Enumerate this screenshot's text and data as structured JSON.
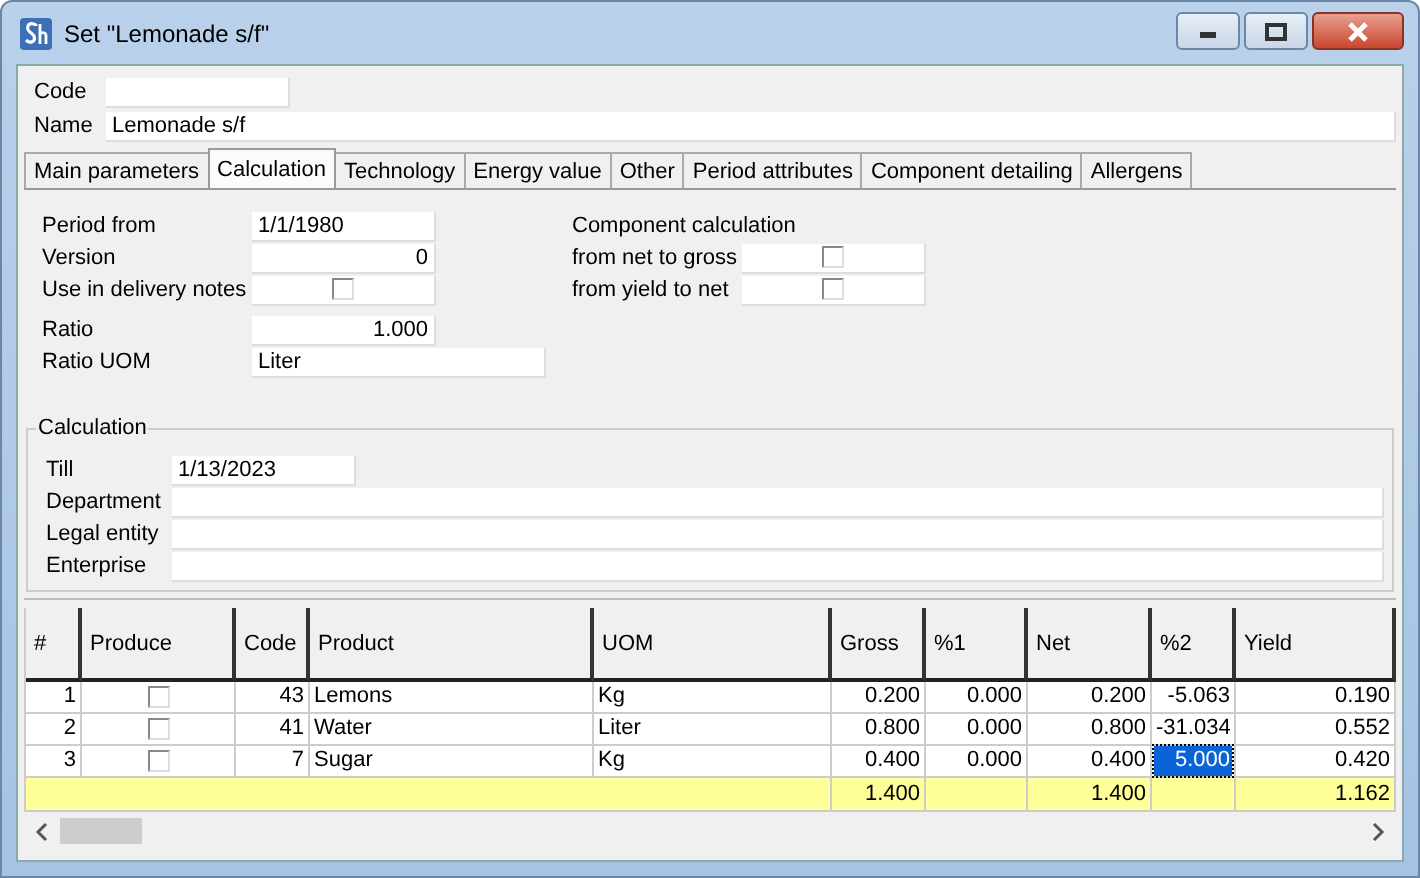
{
  "window": {
    "title": "Set \"Lemonade s/f\""
  },
  "header": {
    "code": {
      "label": "Code"
    },
    "name": {
      "label": "Name",
      "value": "Lemonade s/f"
    }
  },
  "tabs": [
    {
      "label": "Main parameters",
      "selected": false
    },
    {
      "label": "Calculation",
      "selected": true
    },
    {
      "label": "Technology",
      "selected": false
    },
    {
      "label": "Energy value",
      "selected": false
    },
    {
      "label": "Other",
      "selected": false
    },
    {
      "label": "Period attributes",
      "selected": false
    },
    {
      "label": "Component detailing",
      "selected": false
    },
    {
      "label": "Allergens",
      "selected": false
    }
  ],
  "left_fields": [
    {
      "kind": "text",
      "label": "Period from",
      "value": "1/1/1980"
    },
    {
      "kind": "number",
      "label": "Version",
      "value": "0"
    },
    {
      "kind": "checkbox",
      "label": "Use in delivery notes",
      "checked": false
    }
  ],
  "ratio_fields": [
    {
      "kind": "number",
      "label": "Ratio",
      "value": "1.000"
    },
    {
      "kind": "wide",
      "label": "Ratio UOM",
      "value": "Liter"
    }
  ],
  "component_calculation": {
    "title": "Component calculation",
    "options": [
      {
        "label": "from net to gross",
        "checked": false
      },
      {
        "label": "from yield to net",
        "checked": false
      }
    ]
  },
  "calculation_group": {
    "title": "Calculation",
    "till": {
      "label": "Till",
      "value": "1/13/2023"
    },
    "fields": [
      {
        "label": "Department"
      },
      {
        "label": "Legal entity"
      },
      {
        "label": "Enterprise"
      }
    ]
  },
  "table": {
    "columns": [
      "#",
      "Produce",
      "Code",
      "Product",
      "UOM",
      "Gross",
      "%1",
      "Net",
      "%2",
      "Yield"
    ],
    "rows": [
      {
        "num": "1",
        "produce": false,
        "code": "43",
        "product": "Lemons",
        "uom": "Kg",
        "gross": "0.200",
        "p1": "0.000",
        "net": "0.200",
        "p2": {
          "value": "-5.063",
          "selected": false
        },
        "yield": "0.190"
      },
      {
        "num": "2",
        "produce": false,
        "code": "41",
        "product": "Water",
        "uom": "Liter",
        "gross": "0.800",
        "p1": "0.000",
        "net": "0.800",
        "p2": {
          "value": "-31.034",
          "selected": false
        },
        "yield": "0.552"
      },
      {
        "num": "3",
        "produce": false,
        "code": "7",
        "product": "Sugar",
        "uom": "Kg",
        "gross": "0.400",
        "p1": "0.000",
        "net": "0.400",
        "p2": {
          "value": "5.000",
          "selected": true
        },
        "yield": "0.420"
      }
    ],
    "totals": {
      "gross": "1.400",
      "net": "1.400",
      "yield": "1.162"
    }
  }
}
